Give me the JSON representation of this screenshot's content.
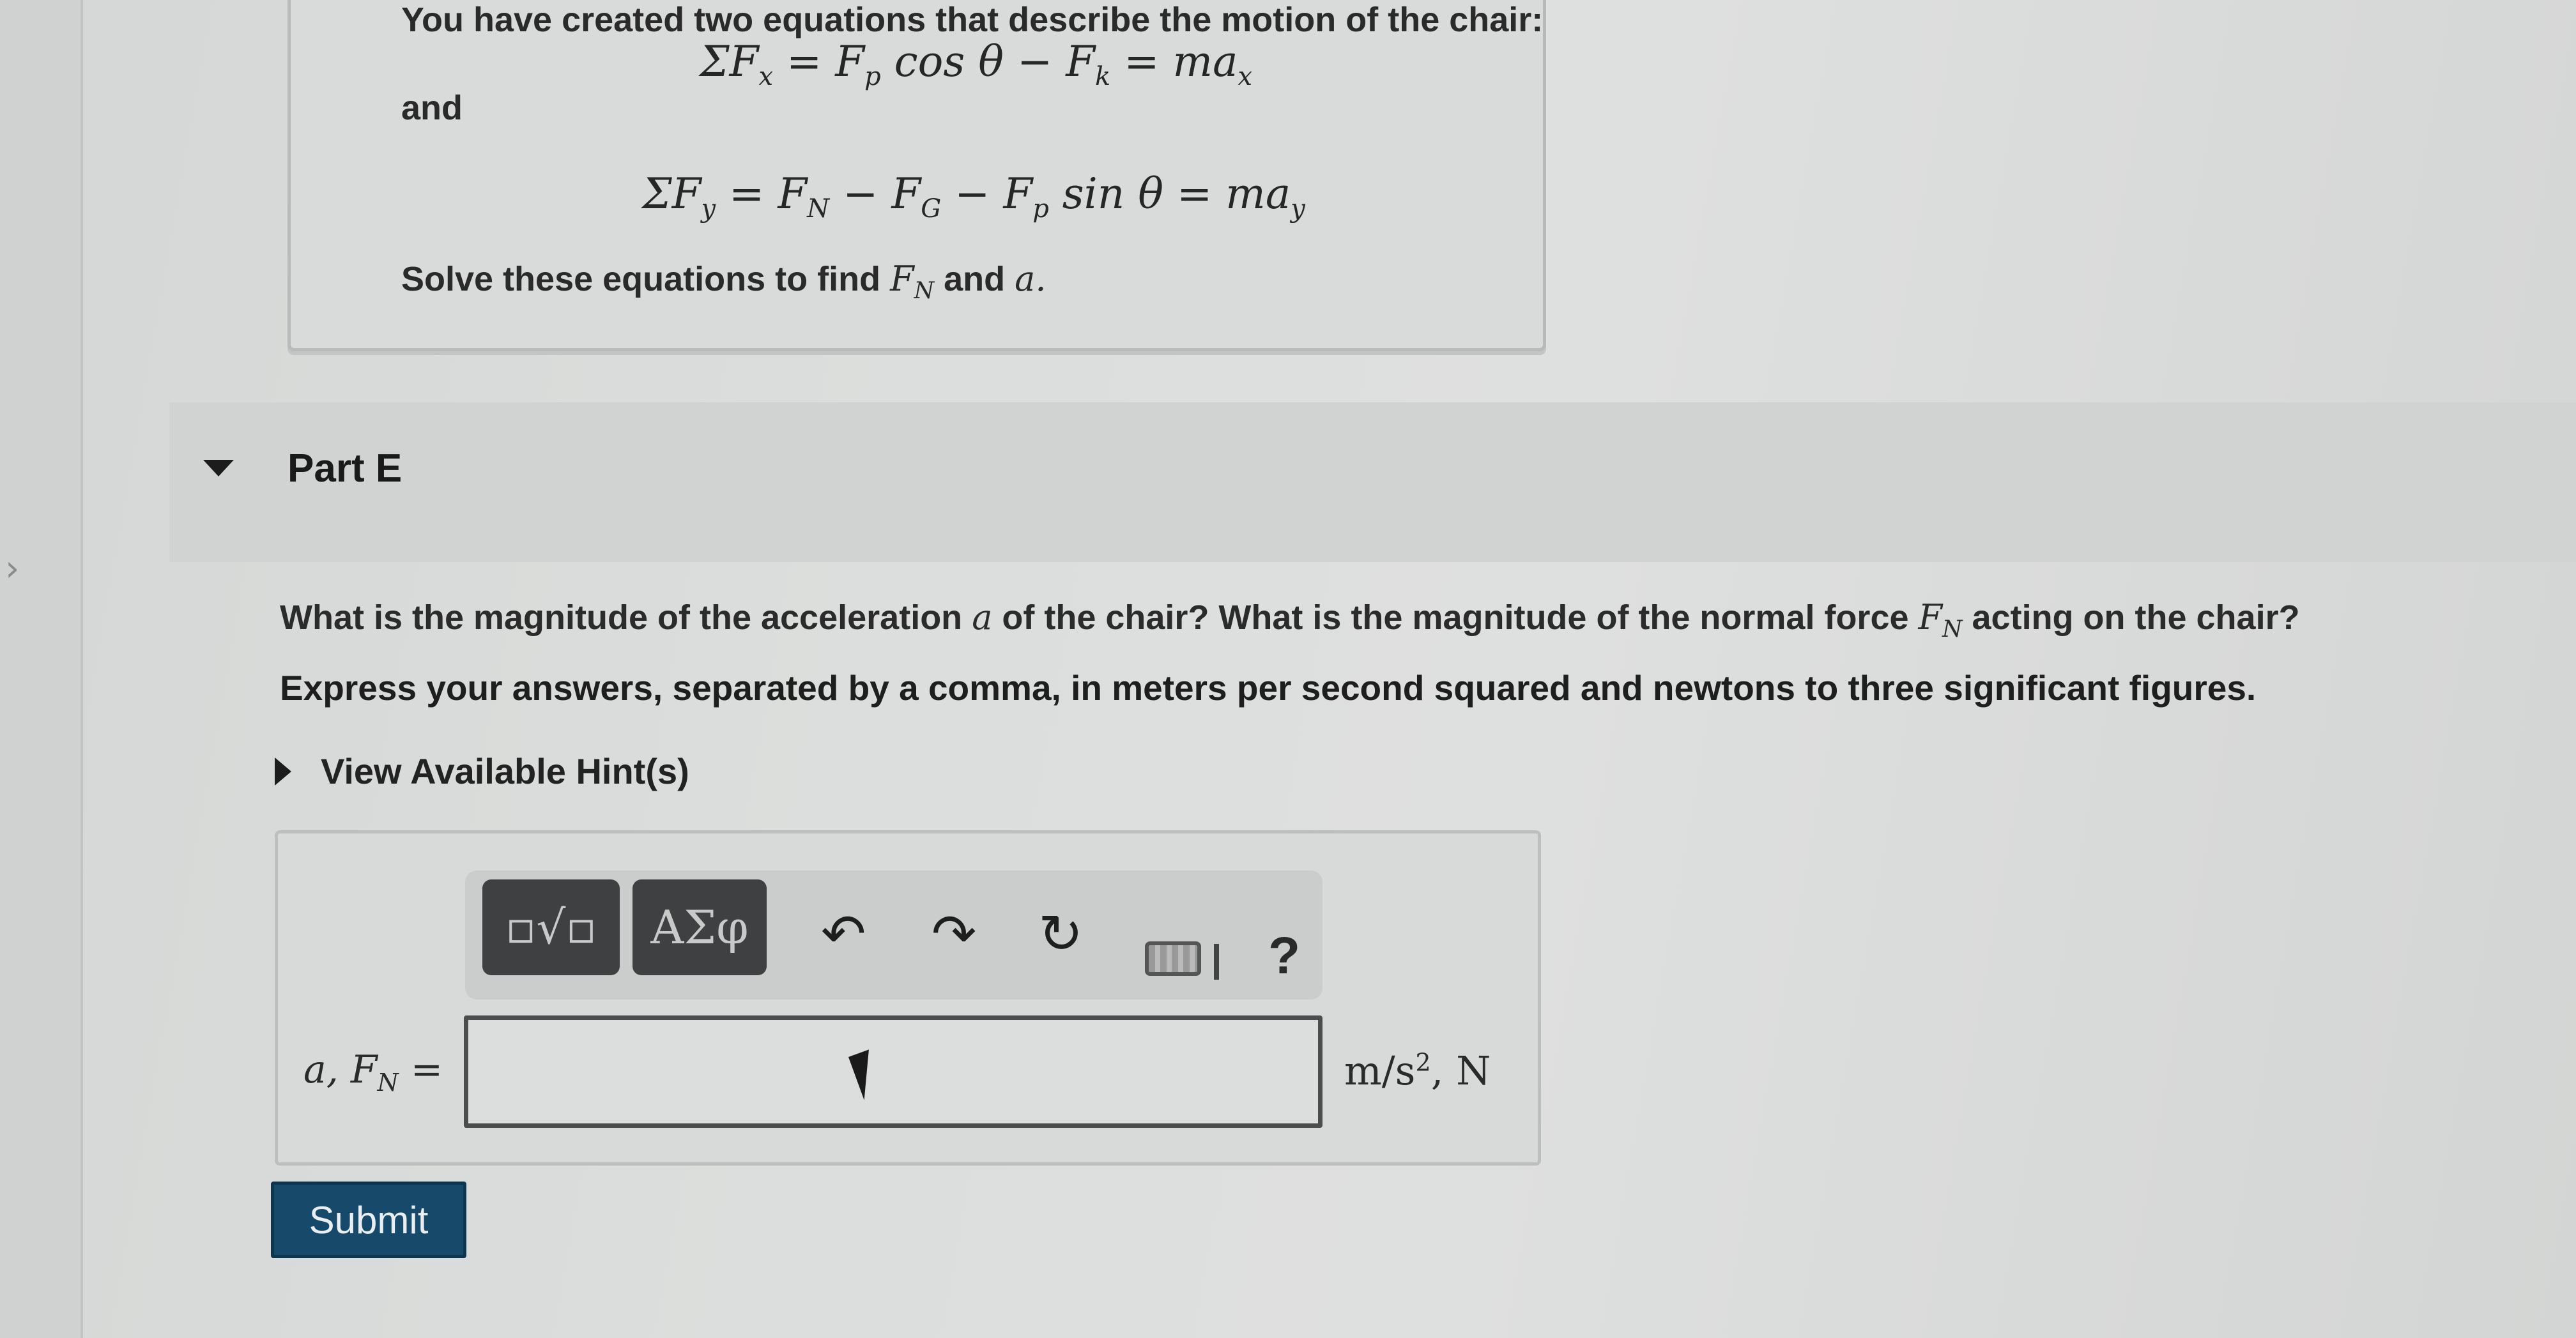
{
  "hint_panel": {
    "intro": "You have created two equations that describe the motion of the chair:",
    "eq1": "ΣF_x = F_p cos θ − F_k = ma_x",
    "and_word": "and",
    "eq2": "ΣF_y = F_N − F_G − F_p sin θ = ma_y",
    "solve_prefix": "Solve these equations to find",
    "solve_var1": "F",
    "solve_var1_sub": "N",
    "solve_and": "and",
    "solve_var2": "a."
  },
  "part": {
    "title": "Part E",
    "question_a": "What is the magnitude of the acceleration",
    "question_var_a": "a",
    "question_b": "of the chair? What is the magnitude of the normal force",
    "question_var_f": "F",
    "question_var_f_sub": "N",
    "question_c": "acting on the chair?",
    "instruction": "Express your answers, separated by a comma, in meters per second squared and newtons to three significant figures.",
    "hint_link": "View Available Hint(s)"
  },
  "toolbar": {
    "templates_label": "▫√▫",
    "greek_label": "AΣφ",
    "undo_icon": "↶",
    "redo_icon": "↷",
    "reset_icon": "↻",
    "help_label": "?"
  },
  "answer": {
    "label_a": "a, F",
    "label_sub": "N",
    "label_eq": "=",
    "value": "",
    "units_main": "m/s",
    "units_sup": "2",
    "units_tail": ", N",
    "submit_label": "Submit"
  }
}
